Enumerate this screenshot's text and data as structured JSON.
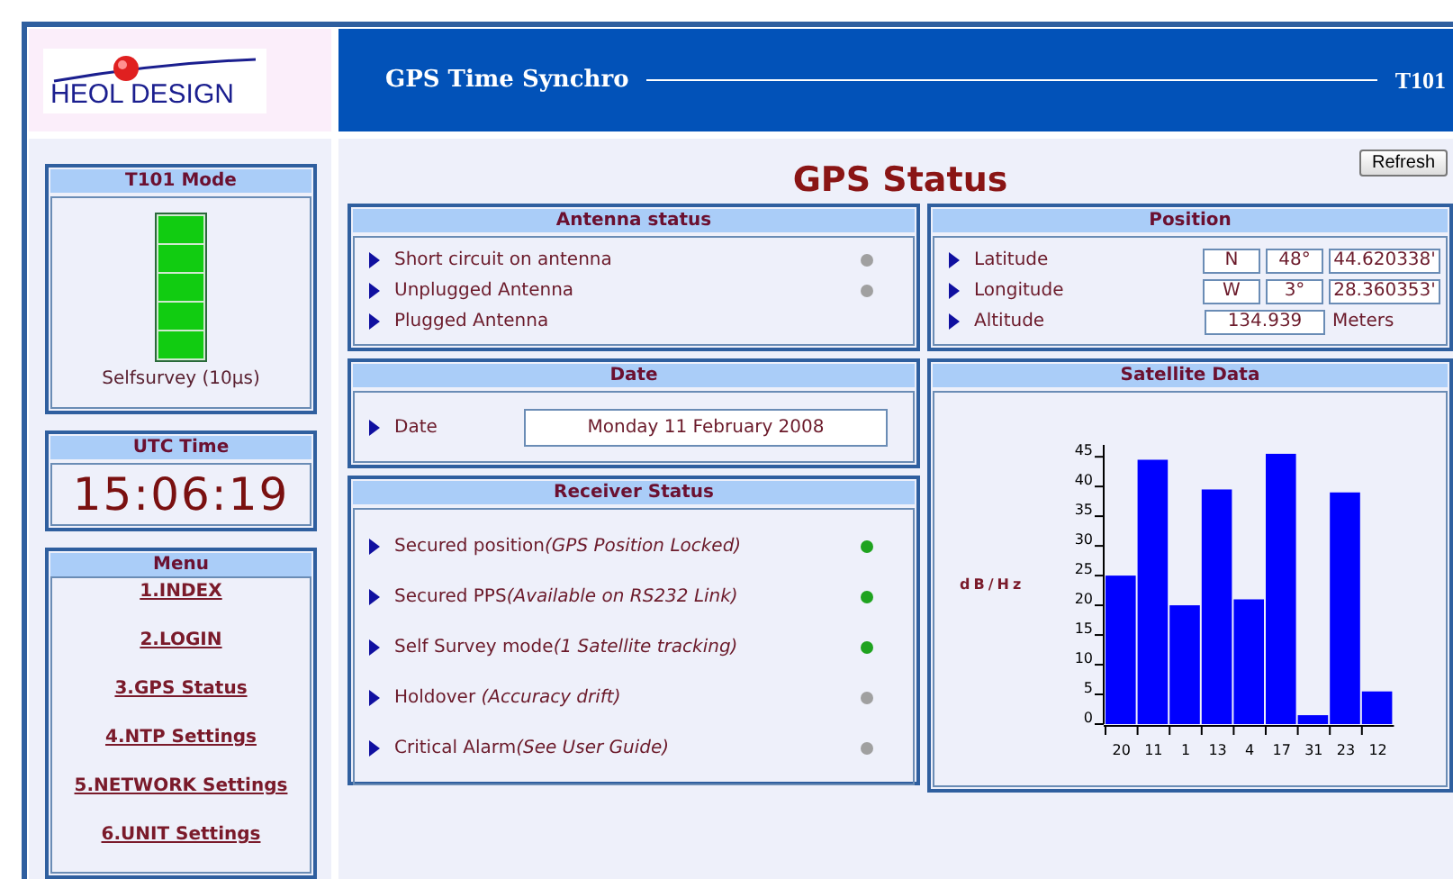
{
  "brand": {
    "logo": "HEOL DESIGN"
  },
  "header": {
    "title": "GPS Time Synchro",
    "model": "T101"
  },
  "mode_panel": {
    "title": "T101 Mode",
    "level": 1,
    "caption": "Selfsurvey (10µs)"
  },
  "utc_panel": {
    "title": "UTC Time",
    "time": "15:06:19"
  },
  "menu": {
    "title": "Menu",
    "items": [
      {
        "label": "1.INDEX"
      },
      {
        "label": "2.LOGIN"
      },
      {
        "label": "3.GPS Status"
      },
      {
        "label": "4.NTP Settings"
      },
      {
        "label": "5.NETWORK Settings"
      },
      {
        "label": "6.UNIT Settings"
      }
    ]
  },
  "page_title": "GPS Status",
  "refresh_button": "Refresh",
  "antenna_status": {
    "title": "Antenna status",
    "items": [
      {
        "label": "Short circuit on antenna",
        "color": "#a0a0a0"
      },
      {
        "label": "Unplugged Antenna",
        "color": "#a0a0a0"
      },
      {
        "label": "Plugged Antenna"
      }
    ]
  },
  "position": {
    "title": "Position",
    "rows": [
      {
        "label": "Latitude",
        "values": [
          "N",
          "48°",
          "44.620338'"
        ]
      },
      {
        "label": "Longitude",
        "values": [
          "W",
          "3°",
          "28.360353'"
        ]
      },
      {
        "label": "Altitude",
        "values": [
          "134.939"
        ],
        "unit": "Meters"
      }
    ]
  },
  "date_panel": {
    "title": "Date",
    "label": "Date",
    "value": "Monday 11 February 2008"
  },
  "receiver_status": {
    "title": "Receiver Status",
    "items": [
      {
        "label": "Secured position",
        "note": "(GPS Position Locked)",
        "color": "#1fa31f"
      },
      {
        "label": "Secured PPS",
        "note": "(Available on RS232 Link)",
        "color": "#1fa31f"
      },
      {
        "label": "Self Survey mode",
        "note": "(1 Satellite tracking)",
        "color": "#1fa31f"
      },
      {
        "label": "Holdover ",
        "note": "(Accuracy drift)",
        "color": "#a0a0a0"
      },
      {
        "label": "Critical Alarm",
        "note": "(See User Guide)",
        "color": "#a0a0a0"
      }
    ]
  },
  "satellite_data": {
    "title": "Satellite Data",
    "chart_data": {
      "type": "bar",
      "ylabel": "dB/Hz",
      "categories": [
        "20",
        "11",
        "1",
        "13",
        "4",
        "17",
        "31",
        "23",
        "12"
      ],
      "series": [
        {
          "color": "#0000ff",
          "values": [
            25,
            44.5,
            20,
            39.5,
            21,
            45.5,
            1.5,
            39,
            5.5
          ]
        }
      ],
      "ylim": [
        0,
        47
      ],
      "yticks": [
        0,
        5,
        10,
        15,
        20,
        25,
        30,
        35,
        40,
        45
      ]
    }
  }
}
